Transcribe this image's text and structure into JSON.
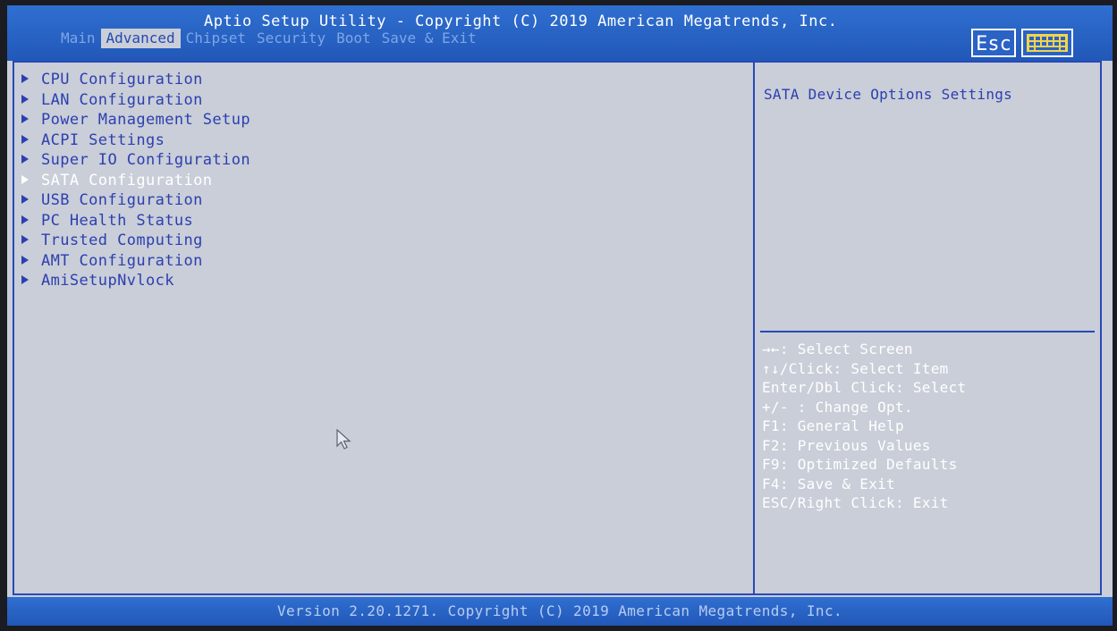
{
  "header": {
    "title": "Aptio Setup Utility - Copyright (C) 2019 American Megatrends, Inc.",
    "tabs": [
      {
        "label": "Main"
      },
      {
        "label": "Advanced"
      },
      {
        "label": "Chipset"
      },
      {
        "label": "Security"
      },
      {
        "label": "Boot"
      },
      {
        "label": "Save & Exit"
      }
    ],
    "active_tab": "Advanced",
    "esc_label": "Esc",
    "keyboard_icon": "keyboard-icon"
  },
  "menu": {
    "items": [
      {
        "label": "CPU Configuration"
      },
      {
        "label": "LAN Configuration"
      },
      {
        "label": "Power Management Setup"
      },
      {
        "label": "ACPI Settings"
      },
      {
        "label": "Super IO Configuration"
      },
      {
        "label": "SATA Configuration"
      },
      {
        "label": "USB Configuration"
      },
      {
        "label": "PC Health Status"
      },
      {
        "label": "Trusted Computing"
      },
      {
        "label": "AMT Configuration"
      },
      {
        "label": "AmiSetupNvlock"
      }
    ],
    "selected": "SATA Configuration"
  },
  "help": {
    "description": "SATA Device Options Settings",
    "keys": [
      "→←: Select Screen",
      "↑↓/Click: Select Item",
      "Enter/Dbl Click: Select",
      "+/- : Change Opt.",
      "F1: General Help",
      "F2: Previous Values",
      "F9: Optimized Defaults",
      "F4: Save & Exit",
      "ESC/Right Click: Exit"
    ]
  },
  "footer": {
    "version": "Version 2.20.1271. Copyright (C) 2019 American Megatrends, Inc."
  },
  "colors": {
    "header_blue": "#2a62c6",
    "panel_bg": "#c9ced8",
    "item_text": "#2d3fb0",
    "selected_text": "#ffffff"
  }
}
